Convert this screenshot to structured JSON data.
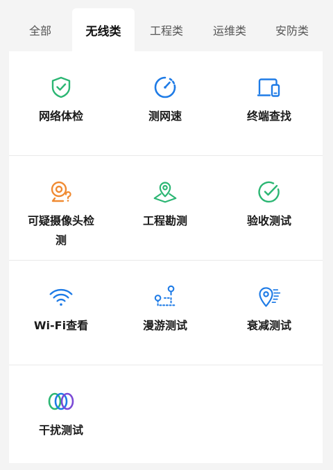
{
  "tabs": [
    {
      "label": "全部",
      "active": false
    },
    {
      "label": "无线类",
      "active": true
    },
    {
      "label": "工程类",
      "active": false
    },
    {
      "label": "运维类",
      "active": false
    },
    {
      "label": "安防类",
      "active": false
    }
  ],
  "tools": [
    {
      "label": "网络体检",
      "icon": "shield-check-icon",
      "color": "#2bb673"
    },
    {
      "label": "测网速",
      "icon": "speedometer-icon",
      "color": "#1e7be6"
    },
    {
      "label": "终端查找",
      "icon": "devices-icon",
      "color": "#1e7be6"
    },
    {
      "label": "可疑摄像头检测",
      "icon": "camera-question-icon",
      "color": "#f08a32"
    },
    {
      "label": "工程勘测",
      "icon": "map-pin-icon",
      "color": "#2bb673"
    },
    {
      "label": "验收测试",
      "icon": "check-circle-icon",
      "color": "#2bb673"
    },
    {
      "label": "Wi-Fi查看",
      "icon": "wifi-icon",
      "color": "#1e7be6"
    },
    {
      "label": "漫游测试",
      "icon": "roaming-icon",
      "color": "#1e7be6"
    },
    {
      "label": "衰减测试",
      "icon": "attenuation-icon",
      "color": "#1e7be6"
    },
    {
      "label": "干扰测试",
      "icon": "interference-rings-icon",
      "color": "#7b4ad6"
    }
  ]
}
